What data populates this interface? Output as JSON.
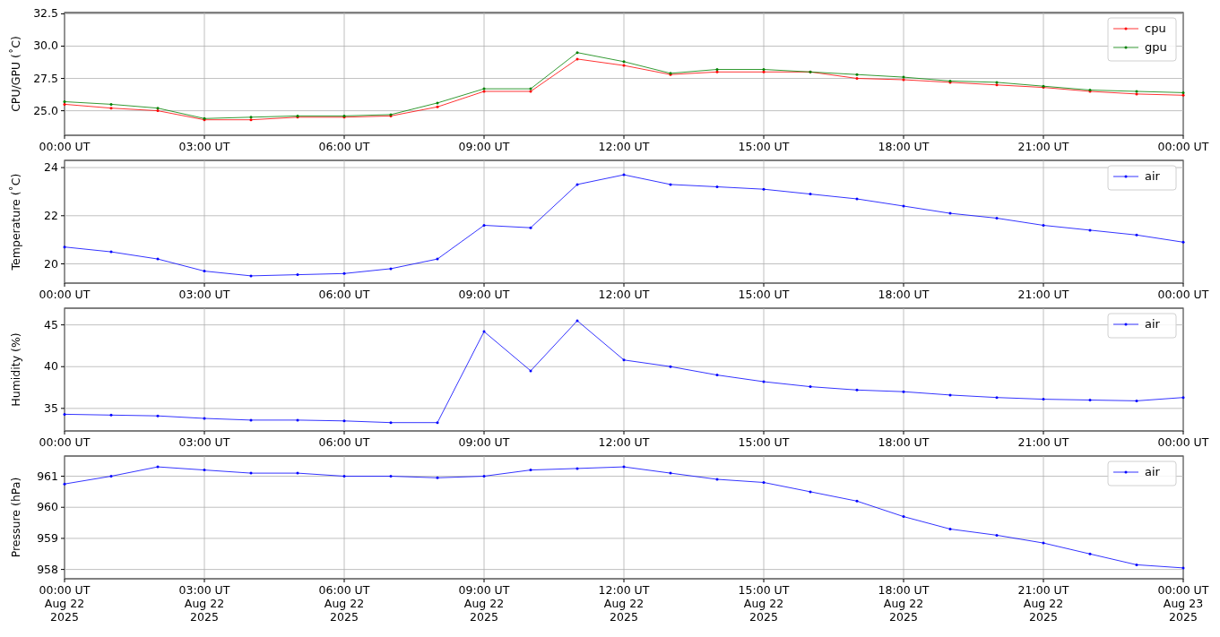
{
  "panels": [
    {
      "chart_data": {
        "type": "line",
        "grid": true,
        "legend": "upper right",
        "ylabel": "CPU/GPU (˚C)",
        "categories": [
          "00:00 UT",
          null,
          null,
          "03:00 UT",
          null,
          null,
          "06:00 UT",
          null,
          null,
          "09:00 UT",
          null,
          null,
          "12:00 UT",
          null,
          null,
          "15:00 UT",
          null,
          null,
          "18:00 UT",
          null,
          null,
          "21:00 UT",
          null,
          null,
          "00:00 UT"
        ],
        "ylim": [
          23.1,
          32.6
        ],
        "yticks": [
          {
            "value": 25,
            "label": "25.0"
          },
          {
            "value": 27.5,
            "label": "27.5"
          },
          {
            "value": 30,
            "label": "30.0"
          },
          {
            "value": 32.5,
            "label": "32.5"
          }
        ],
        "series": [
          {
            "name": "cpu",
            "color": "#ff0000",
            "values": [
              25.5,
              25.2,
              25.0,
              24.3,
              24.3,
              24.5,
              24.5,
              24.6,
              25.3,
              26.5,
              26.5,
              29.0,
              28.5,
              27.8,
              28.0,
              28.0,
              28.0,
              27.5,
              27.4,
              27.2,
              27.0,
              26.8,
              26.5,
              26.3,
              26.2
            ]
          },
          {
            "name": "gpu",
            "color": "#008000",
            "values": [
              25.7,
              25.5,
              25.2,
              24.4,
              24.5,
              24.6,
              24.6,
              24.7,
              25.6,
              26.7,
              26.7,
              29.5,
              28.8,
              27.9,
              28.2,
              28.2,
              28.0,
              27.8,
              27.6,
              27.3,
              27.2,
              26.9,
              26.6,
              26.5,
              26.4
            ]
          }
        ]
      }
    },
    {
      "chart_data": {
        "type": "line",
        "grid": true,
        "legend": "upper right",
        "ylabel": "Temperature (˚C)",
        "categories": [
          "00:00 UT",
          null,
          null,
          "03:00 UT",
          null,
          null,
          "06:00 UT",
          null,
          null,
          "09:00 UT",
          null,
          null,
          "12:00 UT",
          null,
          null,
          "15:00 UT",
          null,
          null,
          "18:00 UT",
          null,
          null,
          "21:00 UT",
          null,
          null,
          "00:00 UT"
        ],
        "ylim": [
          19.2,
          24.3
        ],
        "yticks": [
          20,
          22,
          24
        ],
        "series": [
          {
            "name": "air",
            "color": "#0000ff",
            "values": [
              20.7,
              20.5,
              20.2,
              19.7,
              19.5,
              19.55,
              19.6,
              19.8,
              20.2,
              21.6,
              21.5,
              23.3,
              23.7,
              23.3,
              23.2,
              23.1,
              22.9,
              22.7,
              22.4,
              22.1,
              21.9,
              21.6,
              21.4,
              21.2,
              20.9
            ]
          }
        ]
      }
    },
    {
      "chart_data": {
        "type": "line",
        "grid": true,
        "legend": "upper right",
        "ylabel": "Humidity (%)",
        "categories": [
          "00:00 UT",
          null,
          null,
          "03:00 UT",
          null,
          null,
          "06:00 UT",
          null,
          null,
          "09:00 UT",
          null,
          null,
          "12:00 UT",
          null,
          null,
          "15:00 UT",
          null,
          null,
          "18:00 UT",
          null,
          null,
          "21:00 UT",
          null,
          null,
          "00:00 UT"
        ],
        "ylim": [
          32.3,
          47
        ],
        "yticks": [
          35,
          40,
          45
        ],
        "series": [
          {
            "name": "air",
            "color": "#0000ff",
            "values": [
              34.3,
              34.2,
              34.1,
              33.8,
              33.6,
              33.6,
              33.5,
              33.3,
              33.3,
              44.2,
              39.5,
              45.5,
              40.8,
              40.0,
              39.0,
              38.2,
              37.6,
              37.2,
              37.0,
              36.6,
              36.3,
              36.1,
              36.0,
              35.9,
              36.3
            ]
          }
        ]
      }
    },
    {
      "chart_data": {
        "type": "line",
        "grid": true,
        "legend": "upper right",
        "ylabel": "Pressure (hPa)",
        "categories": [
          "00:00 UT\nAug 22\n2025",
          null,
          null,
          "03:00 UT\nAug 22\n2025",
          null,
          null,
          "06:00 UT\nAug 22\n2025",
          null,
          null,
          "09:00 UT\nAug 22\n2025",
          null,
          null,
          "12:00 UT\nAug 22\n2025",
          null,
          null,
          "15:00 UT\nAug 22\n2025",
          null,
          null,
          "18:00 UT\nAug 22\n2025",
          null,
          null,
          "21:00 UT\nAug 22\n2025",
          null,
          null,
          "00:00 UT\nAug 23\n2025"
        ],
        "ylim": [
          957.7,
          961.65
        ],
        "yticks": [
          958,
          959,
          960,
          961
        ],
        "series": [
          {
            "name": "air",
            "color": "#0000ff",
            "values": [
              960.75,
              961.0,
              961.3,
              961.2,
              961.1,
              961.1,
              961.0,
              961.0,
              960.95,
              961.0,
              961.2,
              961.25,
              961.3,
              961.1,
              960.9,
              960.8,
              960.5,
              960.2,
              959.7,
              959.3,
              959.1,
              958.85,
              958.5,
              958.15,
              958.05
            ]
          }
        ]
      }
    }
  ]
}
